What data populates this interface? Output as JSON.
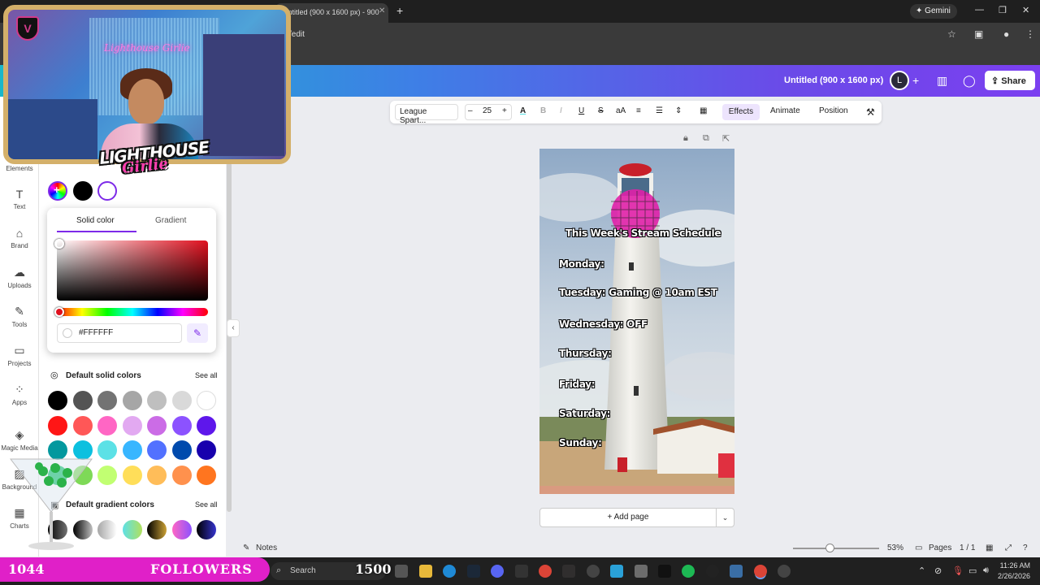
{
  "browser": {
    "tab_title": "Untitled (900 x 1600 px) - 900",
    "url_fragment": "/edit",
    "gemini_label": "Gemini"
  },
  "header": {
    "doc_title": "Untitled (900 x 1600 px)",
    "share_label": "Share"
  },
  "rail": {
    "items": [
      {
        "label": "Elements",
        "icon": "elements-icon"
      },
      {
        "label": "Text",
        "icon": "text-icon"
      },
      {
        "label": "Brand",
        "icon": "brand-icon"
      },
      {
        "label": "Uploads",
        "icon": "uploads-icon"
      },
      {
        "label": "Tools",
        "icon": "tools-icon"
      },
      {
        "label": "Projects",
        "icon": "projects-icon"
      },
      {
        "label": "Apps",
        "icon": "apps-icon"
      },
      {
        "label": "Magic Media",
        "icon": "magic-media-icon"
      },
      {
        "label": "Background",
        "icon": "background-icon"
      },
      {
        "label": "Charts",
        "icon": "charts-icon"
      }
    ]
  },
  "color_panel": {
    "tabs": [
      "Solid color",
      "Gradient"
    ],
    "hex_value": "#FFFFFF",
    "default_solid_title": "Default solid colors",
    "default_gradient_title": "Default gradient colors",
    "see_all": "See all",
    "doc_colors": [
      "#000000",
      "#ffffff"
    ],
    "solid_colors": [
      "#000000",
      "#545454",
      "#737373",
      "#a6a6a6",
      "#bfbfbf",
      "#d9d9d9",
      "#ffffff",
      "#ff1616",
      "#ff5757",
      "#ff66c4",
      "#e2a9f1",
      "#cb6ce6",
      "#8c52ff",
      "#5e17eb",
      "#03989e",
      "#0cc0df",
      "#5ce1e6",
      "#38b6ff",
      "#5271ff",
      "#004aad",
      "#1800ad",
      "#00bf63",
      "#7ed957",
      "#c1ff72",
      "#ffde59",
      "#ffbd59",
      "#ff914d",
      "#ff751f"
    ],
    "gradients": [
      [
        "#000000",
        "#737373"
      ],
      [
        "#000000",
        "#c0c0c0"
      ],
      [
        "#a6a6a6",
        "#ffffff"
      ],
      [
        "#5de0e6",
        "#b1e05d"
      ],
      [
        "#000000",
        "#cba135"
      ],
      [
        "#ff66c4",
        "#8c52ff"
      ],
      [
        "#000000",
        "#3533cd"
      ]
    ]
  },
  "toolbar": {
    "font": "League Spart...",
    "font_size": "25",
    "effects": "Effects",
    "animate": "Animate",
    "position": "Position"
  },
  "canvas": {
    "title": "This Week's Stream Schedule",
    "days": [
      "Monday:",
      "Tuesday: Gaming @ 10am EST",
      "Wednesday: OFF",
      "Thursday:",
      "Friday:",
      "Saturday:",
      "Sunday:"
    ],
    "add_page": "+ Add page"
  },
  "footer": {
    "notes": "Notes",
    "zoom": "53%",
    "pages_label": "Pages",
    "page_count": "1 / 1"
  },
  "taskbar": {
    "search_placeholder": "Search",
    "time": "11:26 AM",
    "date": "2/26/2026"
  },
  "overlay": {
    "neon_sign": "Lighthouse Girlie",
    "logo_line1": "LIGHTHOUSE",
    "logo_line2": "Girlie",
    "followers_count": "1044",
    "followers_label": "FOLLOWERS",
    "followers_goal": "1500"
  }
}
